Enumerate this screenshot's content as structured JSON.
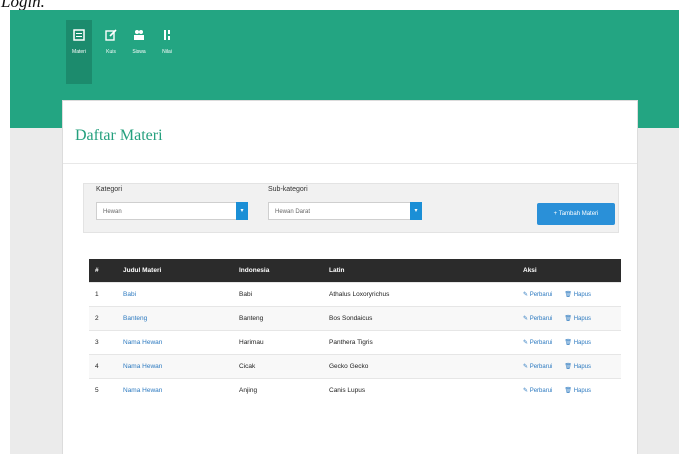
{
  "caption": "Login.",
  "toolbar": {
    "items": [
      {
        "icon": "list-icon",
        "label": "Materi"
      },
      {
        "icon": "edit-icon",
        "label": "Kuis"
      },
      {
        "icon": "users-icon",
        "label": "Siswa"
      },
      {
        "icon": "sort-icon",
        "label": "Nilai"
      }
    ]
  },
  "panel": {
    "title": "Daftar Materi"
  },
  "filters": {
    "kategori_label": "Kategori",
    "kategori_value": "Hewan",
    "subkategori_label": "Sub-kategori",
    "subkategori_value": "Hewan Darat",
    "add_button": "+ Tambah Materi"
  },
  "table": {
    "headers": [
      "#",
      "Judul Materi",
      "Indonesia",
      "Latin",
      "Aksi"
    ],
    "rows": [
      {
        "no": "1",
        "judul": "Babi",
        "indonesia": "Babi",
        "latin": "Athalus Loxoryrichus"
      },
      {
        "no": "2",
        "judul": "Banteng",
        "indonesia": "Banteng",
        "latin": "Bos Sondaicus"
      },
      {
        "no": "3",
        "judul": "Nama Hewan",
        "indonesia": "Harimau",
        "latin": "Panthera Tigris"
      },
      {
        "no": "4",
        "judul": "Nama Hewan",
        "indonesia": "Cicak",
        "latin": "Gecko Gecko"
      },
      {
        "no": "5",
        "judul": "Nama Hewan",
        "indonesia": "Anjing",
        "latin": "Canis Lupus"
      }
    ],
    "edit_label": "Perbarui",
    "delete_label": "Hapus"
  },
  "colors": {
    "header": "#23a582",
    "accent": "#2a90d8"
  }
}
